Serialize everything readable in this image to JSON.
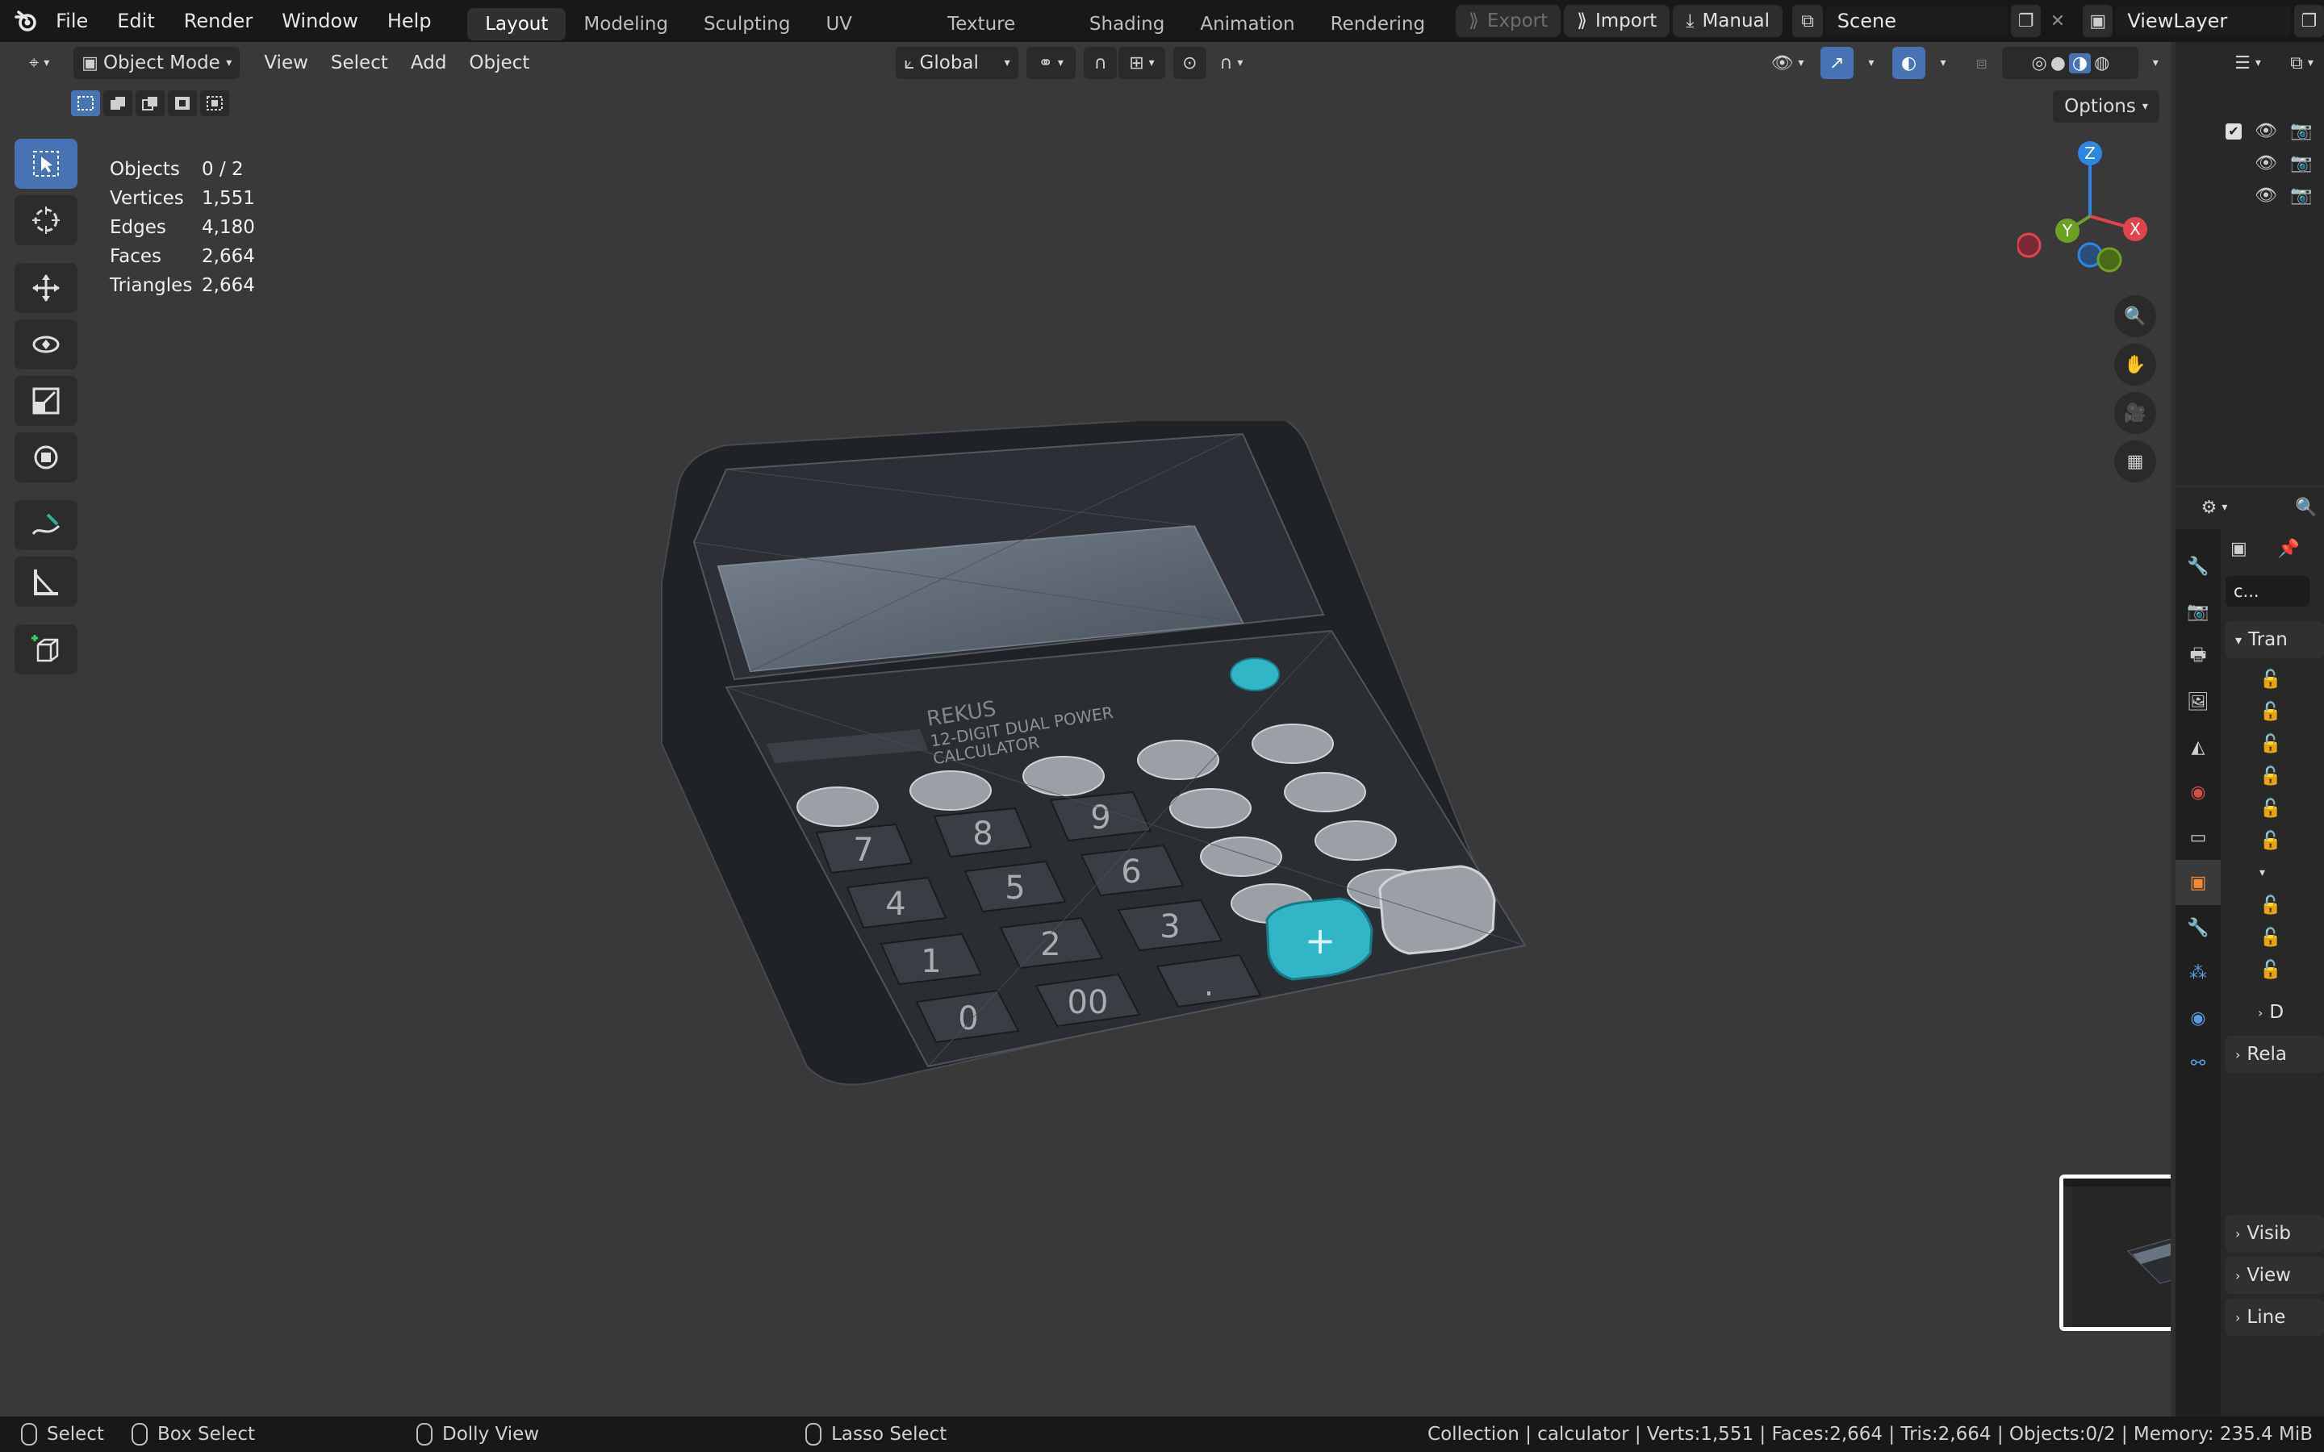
{
  "menu": {
    "file": "File",
    "edit": "Edit",
    "render": "Render",
    "window": "Window",
    "help": "Help"
  },
  "workspaces": [
    "Layout",
    "Modeling",
    "Sculpting",
    "UV Editing",
    "Texture Paint",
    "Shading",
    "Animation",
    "Rendering"
  ],
  "active_workspace": "Layout",
  "top_actions": {
    "export": "Export",
    "import": "Import",
    "manual": "Manual",
    "scene": "Scene",
    "view_layer": "ViewLayer"
  },
  "viewport_header": {
    "mode": "Object Mode",
    "view": "View",
    "select": "Select",
    "add": "Add",
    "object": "Object",
    "orientation": "Global",
    "options": "Options"
  },
  "stats": {
    "objects_label": "Objects",
    "objects_value": "0 / 2",
    "vertices_label": "Vertices",
    "vertices_value": "1,551",
    "edges_label": "Edges",
    "edges_value": "4,180",
    "faces_label": "Faces",
    "faces_value": "2,664",
    "triangles_label": "Triangles",
    "triangles_value": "2,664"
  },
  "gizmo": {
    "z": "Z",
    "y": "Y",
    "x": "X"
  },
  "calculator": {
    "brand": "REKUS",
    "subtitle1": "12-DIGIT DUAL POWER",
    "subtitle2": "CALCULATOR",
    "keys": [
      "7",
      "8",
      "9",
      "4",
      "5",
      "6",
      "1",
      "2",
      "3",
      "0",
      "00",
      "."
    ],
    "plus": "+"
  },
  "properties": {
    "object_name": "c...",
    "transform": "Tran",
    "delta": "D",
    "relations": "Rela",
    "visibility": "Visib",
    "viewport_display": "View",
    "lineart": "Line"
  },
  "status": {
    "select": "Select",
    "box_select": "Box Select",
    "dolly_view": "Dolly View",
    "lasso_select": "Lasso Select",
    "info": "Collection | calculator | Verts:1,551 | Faces:2,664 | Tris:2,664 | Objects:0/2 | Memory: 235.4 MiB"
  },
  "colors": {
    "accent": "#4772b3",
    "axis_x": "#e2444e",
    "axis_y": "#6ea024",
    "axis_z": "#2b86e6",
    "calc_highlight": "#33b5c8"
  }
}
